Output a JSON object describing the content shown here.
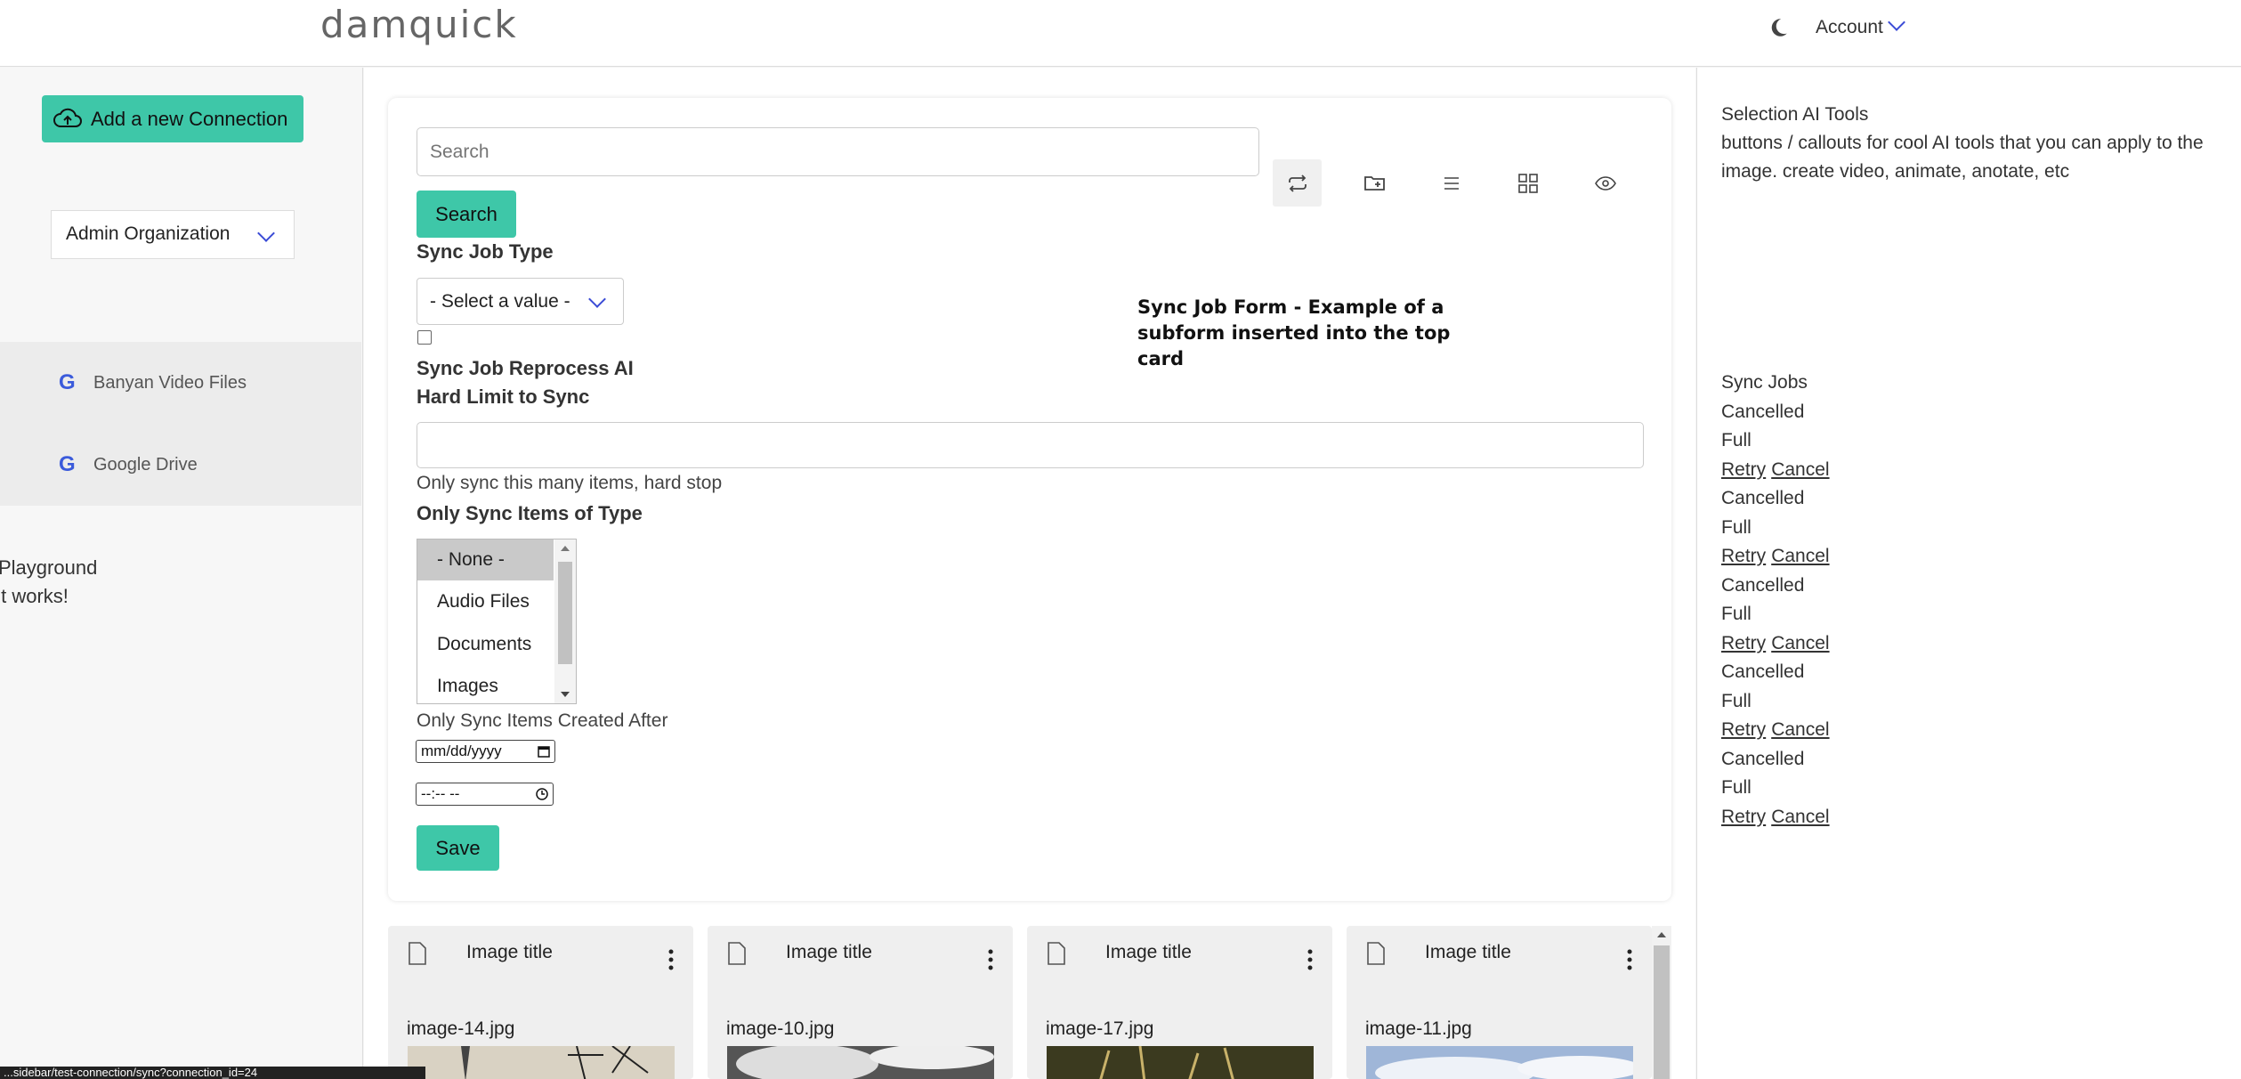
{
  "header": {
    "logo": "damquick",
    "account_label": "Account"
  },
  "sidebar": {
    "add_connection_label": "Add a new Connection",
    "organization": "Admin Organization",
    "connections": [
      {
        "label": "Banyan Video Files",
        "icon": "google-icon"
      },
      {
        "label": "Google Drive",
        "icon": "google-icon"
      }
    ],
    "playground_line1": "Playground",
    "playground_line2": "It works!"
  },
  "search": {
    "placeholder": "Search",
    "button_label": "Search"
  },
  "toolbar": {
    "icons": [
      "sync-icon",
      "folder-add-icon",
      "list-view-icon",
      "grid-view-icon",
      "preview-eye-icon"
    ]
  },
  "form": {
    "sync_job_type_label": "Sync Job Type",
    "sync_job_type_value": "- Select a value -",
    "reprocess_label": "Sync Job Reprocess AI",
    "hard_limit_label": "Hard Limit to Sync",
    "hard_limit_value": "",
    "hard_limit_help": "Only sync this many items, hard stop",
    "item_type_label": "Only Sync Items of Type",
    "item_type_options": [
      "- None -",
      "Audio Files",
      "Documents",
      "Images"
    ],
    "created_after_label": "Only Sync Items Created After",
    "date_placeholder": "mm/dd/yyyy",
    "time_placeholder": "--:-- --",
    "save_label": "Save",
    "note": "Sync Job Form - Example of a subform inserted into the top card"
  },
  "right_panel": {
    "title": "Selection AI Tools",
    "description": "buttons / callouts for cool AI tools that you can apply to the image. create video, animate, anotate, etc",
    "sync_jobs_title": "Sync Jobs",
    "jobs": [
      {
        "status": "Cancelled",
        "type": "Full",
        "retry": "Retry",
        "cancel": "Cancel"
      },
      {
        "status": "Cancelled",
        "type": "Full",
        "retry": "Retry",
        "cancel": "Cancel"
      },
      {
        "status": "Cancelled",
        "type": "Full",
        "retry": "Retry",
        "cancel": "Cancel"
      },
      {
        "status": "Cancelled",
        "type": "Full",
        "retry": "Retry",
        "cancel": "Cancel"
      },
      {
        "status": "Cancelled",
        "type": "Full"
      },
      {
        "retry": "Retry",
        "cancel": "Cancel"
      }
    ]
  },
  "gallery": [
    {
      "title": "Image title",
      "filename": "image-14.jpg"
    },
    {
      "title": "Image title",
      "filename": "image-10.jpg"
    },
    {
      "title": "Image title",
      "filename": "image-17.jpg"
    },
    {
      "title": "Image title",
      "filename": "image-11.jpg"
    }
  ],
  "status_bar": {
    "url": "...sidebar/test-connection/sync?connection_id=24"
  }
}
